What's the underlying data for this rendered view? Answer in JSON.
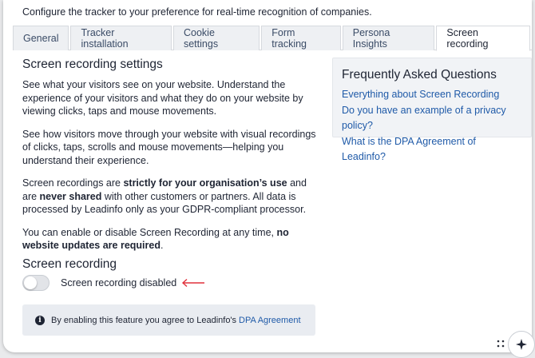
{
  "intro": "Configure the tracker to your preference for real-time recognition of companies.",
  "tabs": [
    {
      "label": "General"
    },
    {
      "label": "Tracker installation"
    },
    {
      "label": "Cookie settings"
    },
    {
      "label": "Form tracking"
    },
    {
      "label": "Persona Insights"
    },
    {
      "label": "Screen recording"
    }
  ],
  "settings": {
    "title": "Screen recording settings",
    "p1": "See what your visitors see on your website. Understand the experience of your visitors and what they do on your website by viewing clicks, taps and mouse movements.",
    "p2": "See how visitors move through your website with visual recordings of clicks, taps, scrolls and mouse movements—helping you understand their experience.",
    "p3_a": "Screen recordings are ",
    "p3_b": "strictly for your organisation’s use",
    "p3_c": " and are ",
    "p3_d": "never shared",
    "p3_e": " with other customers or partners. All data is processed by Leadinfo only as your GDPR-compliant processor.",
    "p4_a": "You can enable or disable Screen Recording at any time, ",
    "p4_b": "no website updates are required",
    "p4_c": "."
  },
  "recording": {
    "title": "Screen recording",
    "toggle_label": "Screen recording disabled",
    "enabled": false
  },
  "notice": {
    "text": "By enabling this feature you agree to Leadinfo's",
    "link": "DPA Agreement"
  },
  "faq": {
    "title": "Frequently Asked Questions",
    "links": [
      "Everything about Screen Recording",
      "Do you have an example of a privacy policy?",
      "What is the DPA Agreement of Leadinfo?"
    ]
  },
  "colors": {
    "link": "#1f5aa8",
    "arrow": "#e0313b",
    "faq_bg": "#f1f3f6",
    "notice_bg": "#e9ecf1"
  }
}
